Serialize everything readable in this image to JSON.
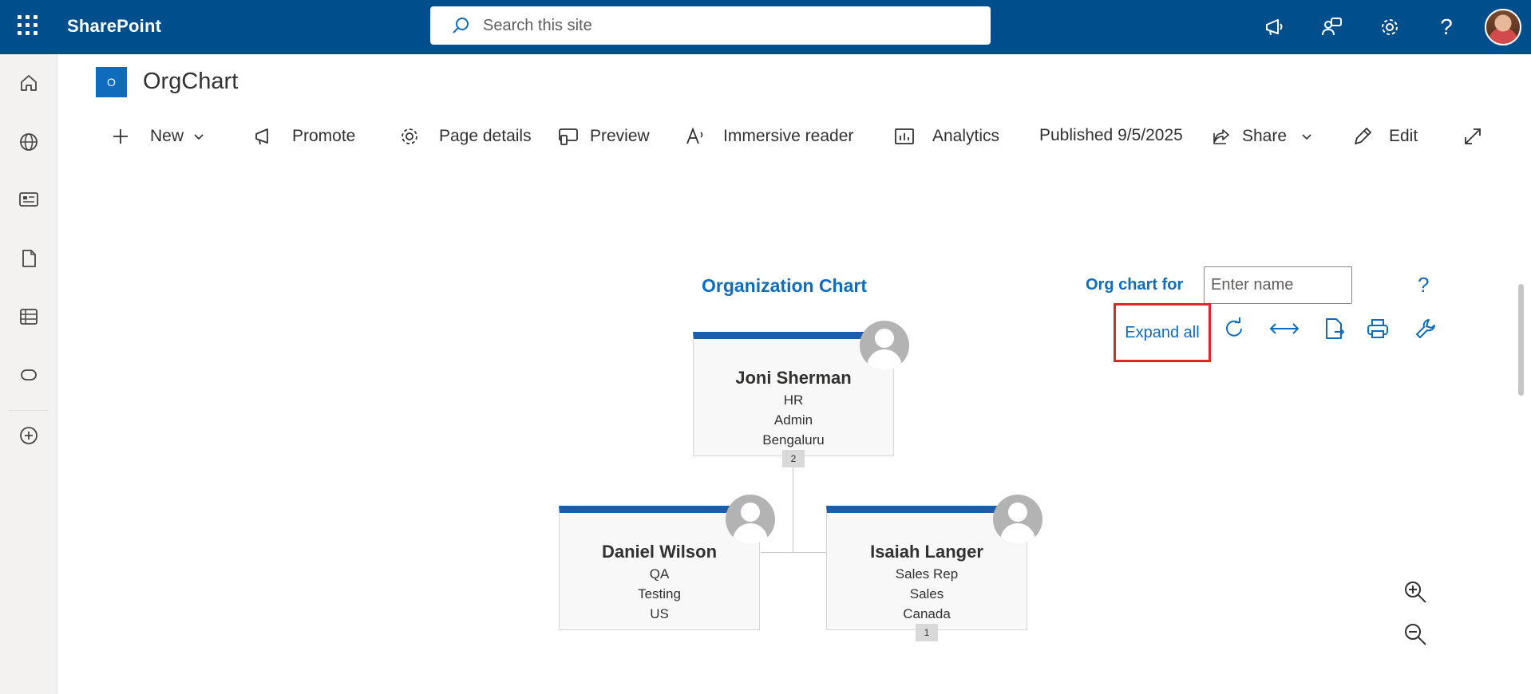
{
  "app": {
    "brand": "SharePoint"
  },
  "search": {
    "placeholder": "Search this site"
  },
  "site": {
    "logo_letter": "O",
    "title": "OrgChart"
  },
  "commands": {
    "new": "New",
    "promote": "Promote",
    "page_details": "Page details",
    "preview": "Preview",
    "immersive_reader": "Immersive reader",
    "analytics": "Analytics",
    "published": "Published 9/5/2025",
    "share": "Share",
    "edit": "Edit"
  },
  "orgchart": {
    "title": "Organization Chart",
    "for_label": "Org chart for",
    "name_placeholder": "Enter name",
    "help": "?",
    "expand_all": "Expand all",
    "accent_color": "#1a5fae",
    "people": [
      {
        "name": "Joni Sherman",
        "title": "HR",
        "department": "Admin",
        "location": "Bengaluru",
        "reports": "2"
      },
      {
        "name": "Daniel Wilson",
        "title": "QA",
        "department": "Testing",
        "location": "US"
      },
      {
        "name": "Isaiah Langer",
        "title": "Sales Rep",
        "department": "Sales",
        "location": "Canada",
        "reports": "1"
      }
    ]
  },
  "icons": {
    "top": [
      "megaphone-icon",
      "people-chat-icon",
      "gear-icon",
      "help-icon"
    ],
    "rail": [
      "home-icon",
      "globe-icon",
      "news-icon",
      "document-icon",
      "list-icon",
      "loop-icon",
      "add-circle-icon"
    ],
    "tools": [
      "refresh-icon",
      "fit-width-icon",
      "export-icon",
      "print-icon",
      "wrench-icon"
    ],
    "zoom": [
      "zoom-in-icon",
      "zoom-out-icon"
    ]
  },
  "colors": {
    "topbar": "#004e8c",
    "accent": "#0f6cbd",
    "highlight": "#d92a2a"
  }
}
